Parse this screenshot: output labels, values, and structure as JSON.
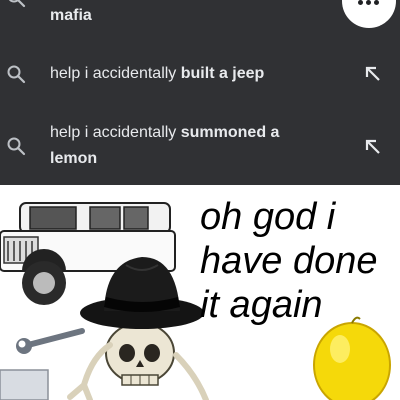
{
  "autocomplete": {
    "suggestions": [
      {
        "prefix": "",
        "bold": "",
        "suffix": "mafia"
      },
      {
        "prefix": "help i accidentally ",
        "bold": "built a jeep",
        "suffix": ""
      },
      {
        "prefix": "help i accidentally ",
        "bold": "summoned a",
        "suffix": "lemon"
      }
    ]
  },
  "meme": {
    "caption_lines": [
      "oh god i",
      "have done",
      "it again"
    ]
  },
  "colors": {
    "dropdown_bg": "#303134",
    "suggestion_text": "#e8eaed",
    "icon": "#bdc1c6",
    "lemon": "#f5d90a"
  },
  "icons": [
    "search-icon",
    "fill-query-arrow-icon",
    "more-options-icon"
  ]
}
